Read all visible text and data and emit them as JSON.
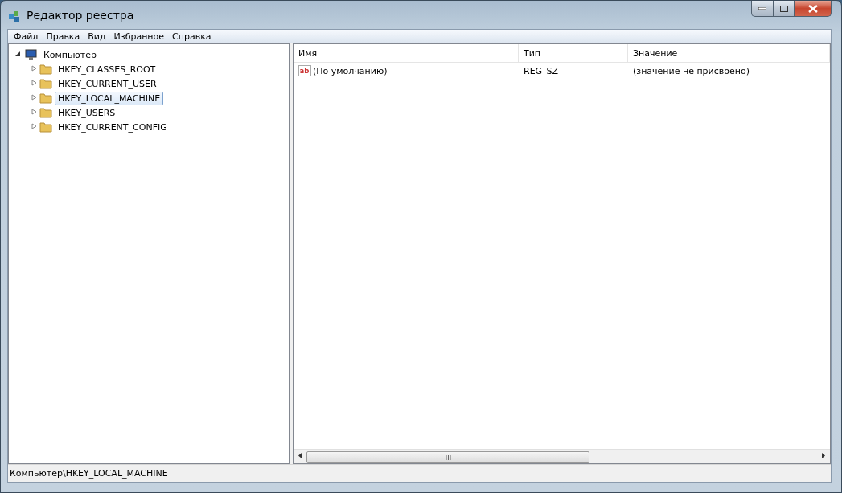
{
  "window": {
    "title": "Редактор реестра"
  },
  "menu": [
    "Файл",
    "Правка",
    "Вид",
    "Избранное",
    "Справка"
  ],
  "tree": {
    "label": "Компьютер",
    "expanded": true,
    "selected": false,
    "children": [
      {
        "label": "HKEY_CLASSES_ROOT",
        "expanded": false,
        "selected": false
      },
      {
        "label": "HKEY_CURRENT_USER",
        "expanded": false,
        "selected": false
      },
      {
        "label": "HKEY_LOCAL_MACHINE",
        "expanded": false,
        "selected": true
      },
      {
        "label": "HKEY_USERS",
        "expanded": false,
        "selected": false
      },
      {
        "label": "HKEY_CURRENT_CONFIG",
        "expanded": false,
        "selected": false
      }
    ]
  },
  "table": {
    "columns": [
      "Имя",
      "Тип",
      "Значение"
    ],
    "rows": [
      {
        "icon": "ab",
        "name": "(По умолчанию)",
        "type": "REG_SZ",
        "value": "(значение не присвоено)"
      }
    ]
  },
  "status_bar": "Компьютер\\HKEY_LOCAL_MACHINE"
}
